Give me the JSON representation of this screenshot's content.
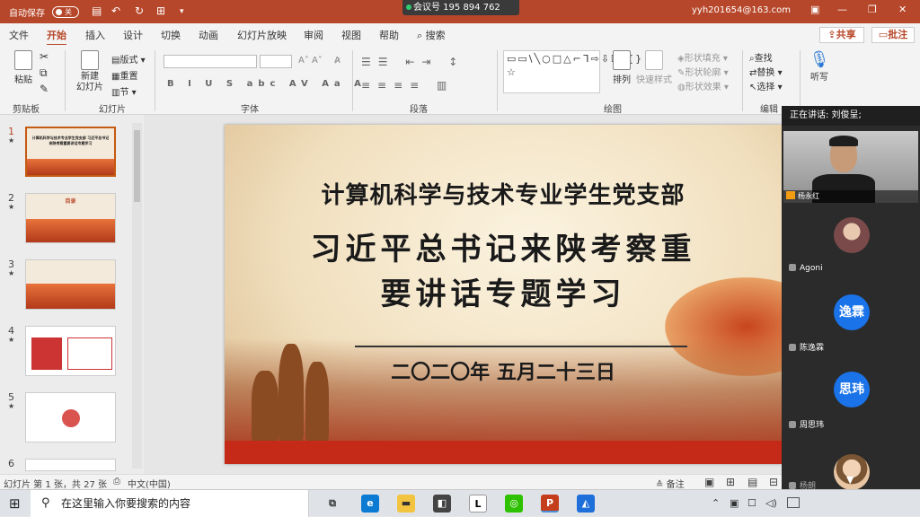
{
  "titlebar": {
    "autosave": "自动保存",
    "toggle": "关",
    "meeting_id": "会议号 195 894 762",
    "account": "yyh201654@163.com",
    "color": "#b7472a"
  },
  "tabs": [
    "文件",
    "开始",
    "插入",
    "设计",
    "切换",
    "动画",
    "幻灯片放映",
    "审阅",
    "视图",
    "帮助"
  ],
  "search_tab": "搜索",
  "share_label": "共享",
  "comment_label": "批注",
  "ribbon": {
    "paste": "粘贴",
    "clipboard": "剪贴板",
    "new_slide": "新建\n幻灯片",
    "layout": "版式",
    "reset": "重置",
    "section": "节",
    "slides_group": "幻灯片",
    "font_group": "字体",
    "paragraph_group": "段落",
    "arrange": "排列",
    "quick_styles": "快速样式",
    "shape_fill": "形状填充",
    "shape_outline": "形状轮廓",
    "shape_effect": "形状效果",
    "drawing_group": "绘图",
    "find": "查找",
    "replace": "替换",
    "select": "选择",
    "editing_group": "编辑",
    "dictate": "听写",
    "font_btns": "B I U S abc AV Aa A",
    "shapes_glyphs": "▭▭\\╲○□△⌐ᒣ⇨⇩☐ᐢ{}☆"
  },
  "thumbnails": [
    {
      "num": "1",
      "title": "计算机科学与技术专业学生党支部 习近平总书记来陕考察重要讲话专题学习"
    },
    {
      "num": "2",
      "title": "目录"
    },
    {
      "num": "3",
      "title": ""
    },
    {
      "num": "4",
      "title": ""
    },
    {
      "num": "5",
      "title": ""
    },
    {
      "num": "6",
      "title": ""
    }
  ],
  "slide": {
    "line1": "计算机科学与技术专业学生党支部",
    "line2": "习近平总书记来陕考察重",
    "line3": "要讲话专题学习",
    "date": "二〇二〇年 五月二十三日"
  },
  "status": {
    "left": "幻灯片 第 1 张，共 27 张",
    "lang": "中文(中国)",
    "notes": "备注"
  },
  "meeting": {
    "speaking": "正在讲话: 刘俊呈;",
    "participants": [
      {
        "name": "杨永红",
        "avatar_text": "",
        "color": ""
      },
      {
        "name": "Agoni",
        "avatar_text": "",
        "color": "#7a4a4a"
      },
      {
        "name": "陈逸霖",
        "avatar_text": "逸霖",
        "color": "#1a73e8"
      },
      {
        "name": "周思玮",
        "avatar_text": "思玮",
        "color": "#1a73e8"
      },
      {
        "name": "杨朗",
        "avatar_text": "",
        "color": "#e8c6a3"
      }
    ]
  },
  "taskbar": {
    "search_placeholder": "在这里输入你要搜索的内容",
    "app_L": "L",
    "app_p": "P"
  }
}
